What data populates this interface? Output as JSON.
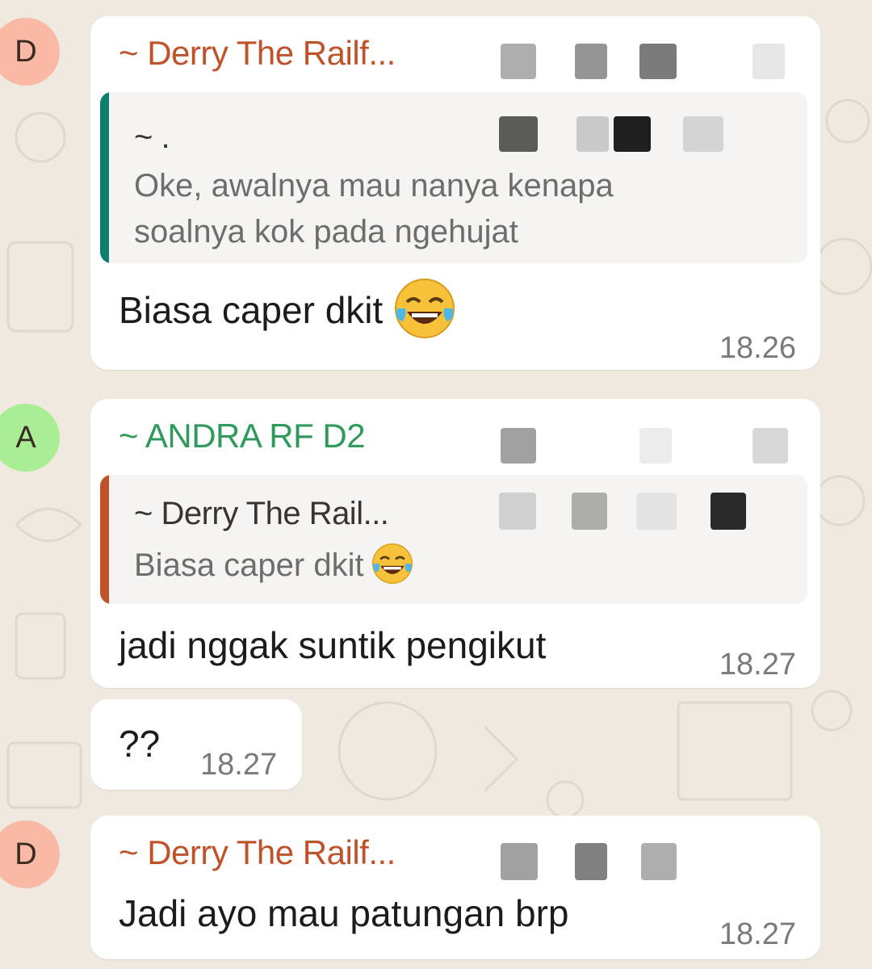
{
  "colors": {
    "wallpaper": "#efe9e0",
    "bubble": "#ffffff",
    "quote_bg": "#f5f4f2",
    "derry_name": "#c0522a",
    "andra_name": "#2f9a5b",
    "derry_avatar": "#f9b9a4",
    "andra_avatar": "#a9ee94",
    "quote_bar_teal": "#0f7f6d",
    "quote_bar_orange": "#c0522a"
  },
  "messages": [
    {
      "avatar_letter": "D",
      "sender": "~ Derry The Railf...",
      "quote": {
        "name": "~ .",
        "text_line1": "Oke, awalnya mau nanya kenapa",
        "text_line2": "soalnya kok pada ngehujat"
      },
      "text": "Biasa caper dkit",
      "emoji": "face-with-tears-of-joy",
      "time": "18.26"
    },
    {
      "avatar_letter": "A",
      "sender": "~ ANDRA RF D2",
      "quote": {
        "name": "~ Derry The Rail...",
        "text": "Biasa caper dkit",
        "emoji": "face-with-tears-of-joy"
      },
      "text": "jadi nggak suntik pengikut",
      "time": "18.27"
    },
    {
      "text": "??",
      "time": "18.27"
    },
    {
      "avatar_letter": "D",
      "sender": "~ Derry The Railf...",
      "text": "Jadi ayo mau patungan brp",
      "time": "18.27"
    }
  ]
}
